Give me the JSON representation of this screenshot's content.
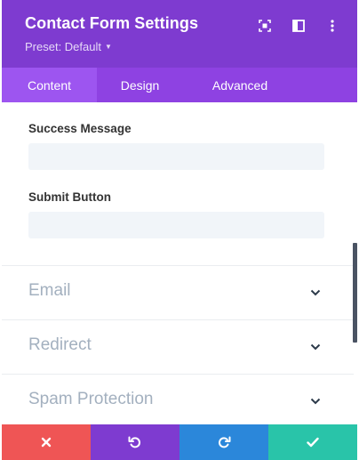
{
  "header": {
    "title": "Contact Form Settings",
    "preset_label": "Preset: Default",
    "icons": [
      "focus-icon",
      "sidebar-layout-icon",
      "more-options-icon"
    ]
  },
  "tabs": [
    {
      "label": "Content",
      "active": true
    },
    {
      "label": "Design",
      "active": false
    },
    {
      "label": "Advanced",
      "active": false
    }
  ],
  "fields": {
    "success_message": {
      "label": "Success Message",
      "value": "",
      "placeholder": ""
    },
    "submit_button": {
      "label": "Submit Button",
      "value": "",
      "placeholder": ""
    }
  },
  "toggles": [
    {
      "label": "Email",
      "expanded": false
    },
    {
      "label": "Redirect",
      "expanded": false
    },
    {
      "label": "Spam Protection",
      "expanded": false
    }
  ],
  "footer": {
    "buttons": [
      "cancel-icon",
      "undo-icon",
      "redo-icon",
      "save-check-icon"
    ]
  },
  "colors": {
    "header_bg": "#7e3bd0",
    "tabs_bg": "#8e42e2",
    "tab_active_bg": "#9d55f0",
    "cancel": "#ef5555",
    "undo": "#7e3bd0",
    "redo": "#2b87da",
    "save": "#29c4a9"
  }
}
